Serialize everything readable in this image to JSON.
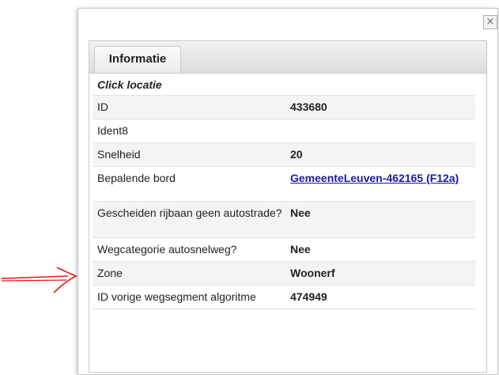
{
  "popup": {
    "close_label": "×",
    "tab_label": "Informatie",
    "section_title": "Click locatie",
    "rows": [
      {
        "label": "ID",
        "value": "433680"
      },
      {
        "label": "Ident8",
        "value": ""
      },
      {
        "label": "Snelheid",
        "value": "20"
      },
      {
        "label": "Bepalende bord",
        "value": "GemeenteLeuven-462165 (F12a)"
      },
      {
        "label": "Gescheiden rijbaan geen autostrade?",
        "value": "Nee"
      },
      {
        "label": "Wegcategorie autosnelweg?",
        "value": "Nee"
      },
      {
        "label": "Zone",
        "value": "Woonerf"
      },
      {
        "label": "ID vorige wegsegment algoritme",
        "value": "474949"
      }
    ]
  },
  "annotation": {
    "arrow_color": "#e01b1b"
  }
}
